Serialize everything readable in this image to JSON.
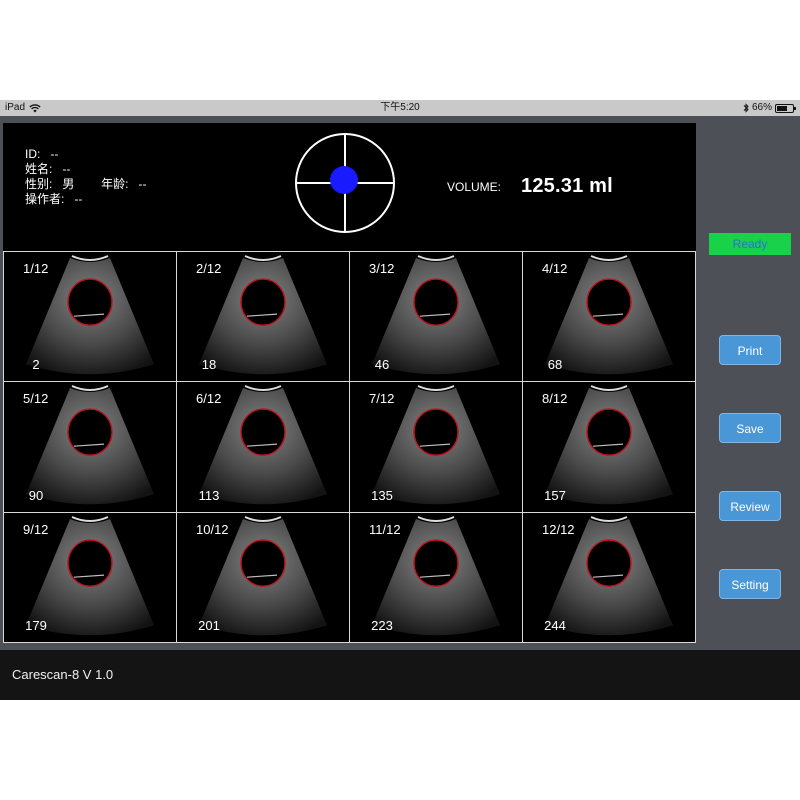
{
  "status_bar": {
    "device": "iPad",
    "time": "下午5:20",
    "battery": "66%",
    "battery_level": 0.66,
    "icons": [
      "wifi-icon",
      "bluetooth-icon",
      "battery-icon"
    ]
  },
  "patient": {
    "id_label": "ID:",
    "id_value": "--",
    "name_label": "姓名:",
    "name_value": "--",
    "sex_label": "性别:",
    "sex_value": "男",
    "age_label": "年龄:",
    "age_value": "--",
    "operator_label": "操作者:",
    "operator_value": "--"
  },
  "volume": {
    "label": "VOLUME:",
    "value": "125.31 ml"
  },
  "colors": {
    "crosshair_dot": "#1a1aff",
    "ready_bg": "#18d24a",
    "ready_text": "#2c6fd6",
    "button_bg": "#4a97d7",
    "contour": "#c0121c"
  },
  "status": {
    "label": "Ready"
  },
  "buttons": {
    "print": "Print",
    "save": "Save",
    "review": "Review",
    "setting": "Setting"
  },
  "scans": [
    {
      "index": "1/12",
      "frame": "2"
    },
    {
      "index": "2/12",
      "frame": "18"
    },
    {
      "index": "3/12",
      "frame": "46"
    },
    {
      "index": "4/12",
      "frame": "68"
    },
    {
      "index": "5/12",
      "frame": "90"
    },
    {
      "index": "6/12",
      "frame": "113"
    },
    {
      "index": "7/12",
      "frame": "135"
    },
    {
      "index": "8/12",
      "frame": "157"
    },
    {
      "index": "9/12",
      "frame": "179"
    },
    {
      "index": "10/12",
      "frame": "201"
    },
    {
      "index": "11/12",
      "frame": "223"
    },
    {
      "index": "12/12",
      "frame": "244"
    }
  ],
  "footer": {
    "app_name": "Carescan-8 V 1.0"
  }
}
